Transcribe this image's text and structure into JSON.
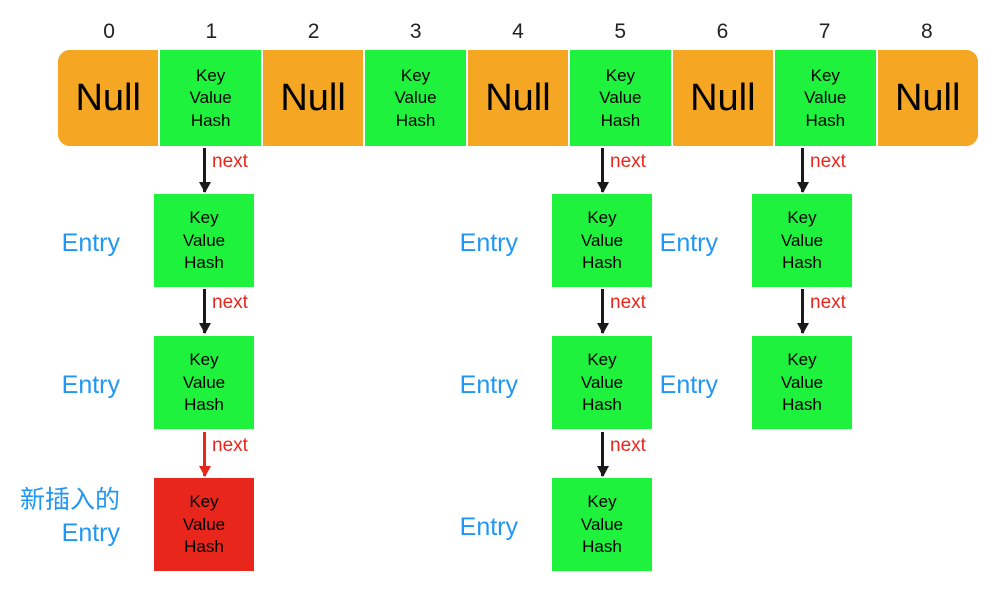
{
  "diagram": {
    "title": "HashMap bucket array with separate chaining",
    "colors": {
      "bucket_null": "#F5A623",
      "bucket_node": "#1EF23C",
      "entry_green": "#1EF23C",
      "entry_new_red": "#E8261C",
      "label_blue": "#2196F3",
      "next_red": "#E8261C",
      "arrow_black": "#1A1A1A",
      "background": "#FFFFFF"
    },
    "node_text": {
      "key": "Key",
      "value": "Value",
      "hash": "Hash"
    },
    "null_text": "Null",
    "next_label": "next",
    "entry_label": "Entry",
    "new_entry_label_cn": "新插入的",
    "new_entry_label_en": "Entry"
  },
  "index_labels": [
    "0",
    "1",
    "2",
    "3",
    "4",
    "5",
    "6",
    "7",
    "8"
  ],
  "buckets": [
    {
      "index": "0",
      "type": "null",
      "text": "Null"
    },
    {
      "index": "1",
      "type": "node",
      "key": "Key",
      "value": "Value",
      "hash": "Hash"
    },
    {
      "index": "2",
      "type": "null",
      "text": "Null"
    },
    {
      "index": "3",
      "type": "node",
      "key": "Key",
      "value": "Value",
      "hash": "Hash"
    },
    {
      "index": "4",
      "type": "null",
      "text": "Null"
    },
    {
      "index": "5",
      "type": "node",
      "key": "Key",
      "value": "Value",
      "hash": "Hash"
    },
    {
      "index": "6",
      "type": "null",
      "text": "Null"
    },
    {
      "index": "7",
      "type": "node",
      "key": "Key",
      "value": "Value",
      "hash": "Hash"
    },
    {
      "index": "8",
      "type": "null",
      "text": "Null"
    }
  ],
  "chains": [
    {
      "bucket_index": "1",
      "nodes": [
        {
          "label": "Entry",
          "key": "Key",
          "value": "Value",
          "hash": "Hash",
          "color": "green",
          "arrow_label": "next",
          "arrow_color": "black"
        },
        {
          "label": "Entry",
          "key": "Key",
          "value": "Value",
          "hash": "Hash",
          "color": "green",
          "arrow_label": "next",
          "arrow_color": "black"
        },
        {
          "label_cn": "新插入的",
          "label": "Entry",
          "key": "Key",
          "value": "Value",
          "hash": "Hash",
          "color": "red",
          "arrow_label": "next",
          "arrow_color": "red"
        }
      ]
    },
    {
      "bucket_index": "5",
      "nodes": [
        {
          "label": "Entry",
          "key": "Key",
          "value": "Value",
          "hash": "Hash",
          "color": "green",
          "arrow_label": "next",
          "arrow_color": "black"
        },
        {
          "label": "Entry",
          "key": "Key",
          "value": "Value",
          "hash": "Hash",
          "color": "green",
          "arrow_label": "next",
          "arrow_color": "black"
        },
        {
          "label": "Entry",
          "key": "Key",
          "value": "Value",
          "hash": "Hash",
          "color": "green",
          "arrow_label": "next",
          "arrow_color": "black"
        }
      ]
    },
    {
      "bucket_index": "7",
      "nodes": [
        {
          "label": "Entry",
          "key": "Key",
          "value": "Value",
          "hash": "Hash",
          "color": "green",
          "arrow_label": "next",
          "arrow_color": "black"
        },
        {
          "label": "Entry",
          "key": "Key",
          "value": "Value",
          "hash": "Hash",
          "color": "green",
          "arrow_label": "next",
          "arrow_color": "black"
        }
      ]
    }
  ]
}
